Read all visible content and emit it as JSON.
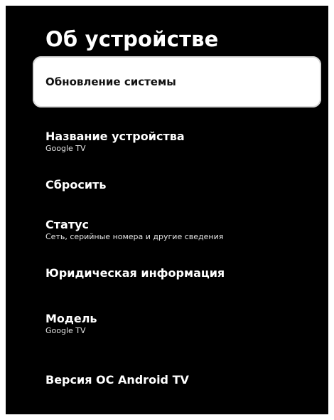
{
  "page": {
    "title": "Об устройстве"
  },
  "menu": {
    "items": [
      {
        "label": "Обновление системы",
        "subtitle": "",
        "focused": true
      },
      {
        "label": "Название устройства",
        "subtitle": "Google TV"
      },
      {
        "label": "Сбросить",
        "subtitle": ""
      },
      {
        "label": "Статус",
        "subtitle": "Сеть, серийные номера и другие сведения"
      },
      {
        "label": "Юридическая информация",
        "subtitle": ""
      },
      {
        "label": "Модель",
        "subtitle": "Google TV"
      },
      {
        "label": "Версия ОС Android TV",
        "subtitle": ""
      }
    ]
  },
  "colors": {
    "background": "#000000",
    "text": "#ffffff",
    "focus_background": "#ffffff",
    "focus_text": "#111111"
  }
}
